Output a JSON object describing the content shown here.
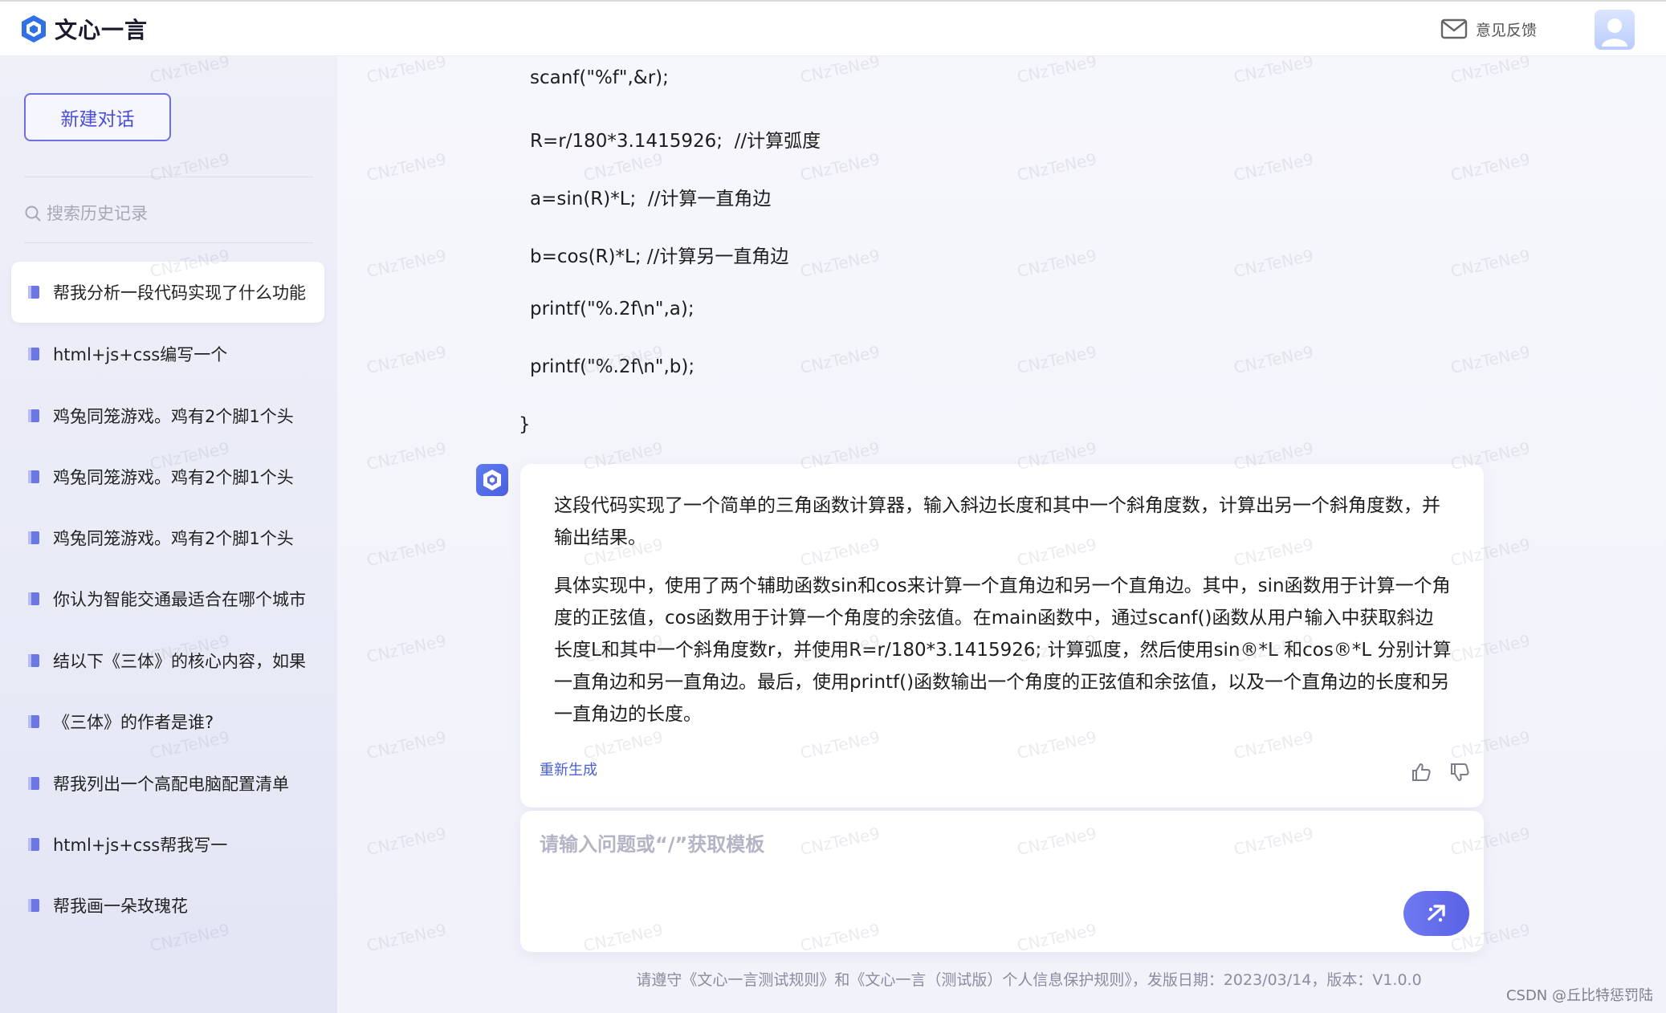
{
  "header": {
    "logo_text": "文心一言",
    "feedback_label": "意见反馈"
  },
  "sidebar": {
    "new_chat_label": "新建对话",
    "search_placeholder": "搜索历史记录",
    "items": [
      {
        "label": "帮我分析一段代码实现了什么功能"
      },
      {
        "label": "html+js+css编写一个"
      },
      {
        "label": "鸡兔同笼游戏。鸡有2个脚1个头"
      },
      {
        "label": "鸡兔同笼游戏。鸡有2个脚1个头"
      },
      {
        "label": "鸡兔同笼游戏。鸡有2个脚1个头"
      },
      {
        "label": "你认为智能交通最适合在哪个城市"
      },
      {
        "label": "结以下《三体》的核心内容，如果"
      },
      {
        "label": "《三体》的作者是谁?"
      },
      {
        "label": "帮我列出一个高配电脑配置清单"
      },
      {
        "label": "html+js+css帮我写一"
      },
      {
        "label": "帮我画一朵玫瑰花"
      }
    ]
  },
  "conversation": {
    "code_lines": [
      "scanf(\"%f\",&r);",
      "R=r/180*3.1415926;  //计算弧度",
      "a=sin(R)*L;  //计算一直角边",
      "b=cos(R)*L; //计算另一直角边",
      "printf(\"%.2f\\n\",a);",
      "printf(\"%.2f\\n\",b);",
      "}"
    ],
    "answer_paragraph_1": "这段代码实现了一个简单的三角函数计算器，输入斜边长度和其中一个斜角度数，计算出另一个斜角度数，并输出结果。",
    "answer_paragraph_2": "具体实现中，使用了两个辅助函数sin和cos来计算一个直角边和另一个直角边。其中，sin函数用于计算一个角度的正弦值，cos函数用于计算一个角度的余弦值。在main函数中，通过scanf()函数从用户输入中获取斜边长度L和其中一个斜角度数r，并使用R=r/180*3.1415926; 计算弧度，然后使用sin®*L 和cos®*L 分别计算一直角边和另一直角边。最后，使用printf()函数输出一个角度的正弦值和余弦值，以及一个直角边的长度和另一直角边的长度。",
    "regenerate_label": "重新生成"
  },
  "input": {
    "placeholder": "请输入问题或“/”获取模板"
  },
  "footer": {
    "note": "请遵守《文心一言测试规则》和《文心一言（测试版）个人信息保护规则》，发版日期：2023/03/14，版本：V1.0.0",
    "csdn_mark": "CSDN @丘比特惩罚陆"
  },
  "watermark_text": "CNzTeNe9",
  "colors": {
    "accent": "#4b4dd9",
    "send_button": "#5a62e6"
  }
}
